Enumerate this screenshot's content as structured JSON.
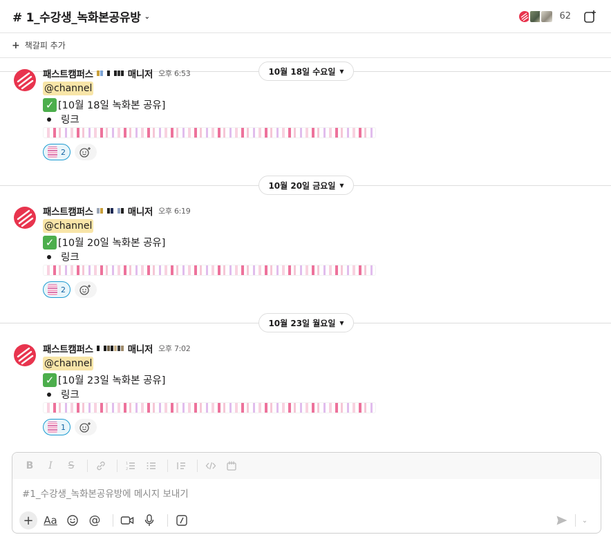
{
  "header": {
    "channel_title": "# 1_수강생_녹화본공유방",
    "member_count": "62"
  },
  "bookmark": {
    "label": "책갈피 추가"
  },
  "days": [
    {
      "date_label": "10월 18일 수요일",
      "message": {
        "sender": "패스트캠퍼스",
        "role": "매니저",
        "time": "오후 6:53",
        "mention": "@channel",
        "notice": "[10월 18일 녹화본 공유]",
        "bullet": "링크",
        "reaction_count": "2"
      }
    },
    {
      "date_label": "10월 20일 금요일",
      "message": {
        "sender": "패스트캠퍼스",
        "role": "매니저",
        "time": "오후 6:19",
        "mention": "@channel",
        "notice": "[10월 20일 녹화본 공유]",
        "bullet": "링크",
        "reaction_count": "2"
      }
    },
    {
      "date_label": "10월 23일 월요일",
      "message": {
        "sender": "패스트캠퍼스",
        "role": "매니저",
        "time": "오후 7:02",
        "mention": "@channel",
        "notice": "[10월 23일 녹화본 공유]",
        "bullet": "링크",
        "reaction_count": "1"
      }
    }
  ],
  "composer": {
    "placeholder": "#1_수강생_녹화본공유방에 메시지 보내기"
  },
  "icons": {
    "format_bar": [
      "bold-icon",
      "italic-icon",
      "strikethrough-icon",
      "link-icon",
      "ordered-list-icon",
      "bulleted-list-icon",
      "blockquote-icon",
      "code-icon",
      "code-block-icon"
    ],
    "action_bar": [
      "plus-icon",
      "text-format-icon",
      "emoji-icon",
      "mention-icon",
      "video-icon",
      "microphone-icon",
      "slash-command-icon"
    ]
  },
  "colors": {
    "brand_red": "#e8344e",
    "mention_bg": "#f8e5a8",
    "reaction_border": "#1d9bd1",
    "check_green": "#4cae4c"
  }
}
